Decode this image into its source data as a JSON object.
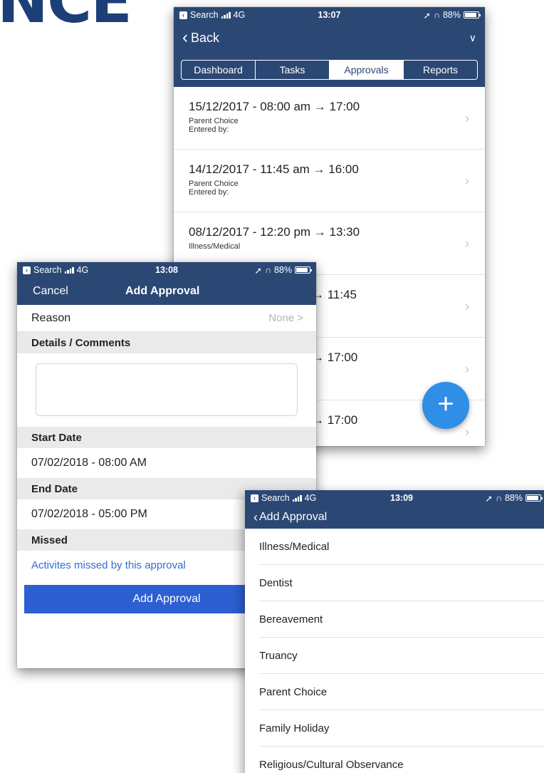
{
  "phone_list": {
    "status": {
      "back_app": "Search",
      "network": "4G",
      "time": "13:07",
      "battery": "88%"
    },
    "nav": {
      "back_label": "Back"
    },
    "tabs": [
      {
        "label": "Dashboard",
        "active": false
      },
      {
        "label": "Tasks",
        "active": false
      },
      {
        "label": "Approvals",
        "active": true
      },
      {
        "label": "Reports",
        "active": false
      }
    ],
    "entries": [
      {
        "title": "15/12/2017 - 08:00 am → 17:00",
        "reason": "Parent Choice",
        "entered_by": "Entered by:"
      },
      {
        "title": "14/12/2017 - 11:45 am → 16:00",
        "reason": "Parent Choice",
        "entered_by": "Entered by:"
      },
      {
        "title": "08/12/2017 - 12:20 pm → 13:30",
        "reason": "Illness/Medical",
        "entered_by": ""
      },
      {
        "title": "→ 11:45",
        "reason": "",
        "entered_by": ""
      },
      {
        "title": "→ 17:00",
        "reason": "",
        "entered_by": ""
      },
      {
        "title": "→ 17:00",
        "reason": "",
        "entered_by": ""
      }
    ],
    "fab_icon": "+"
  },
  "phone_form": {
    "status": {
      "back_app": "Search",
      "network": "4G",
      "time": "13:08",
      "battery": "88%"
    },
    "nav": {
      "cancel_label": "Cancel",
      "title": "Add Approval"
    },
    "reason_label": "Reason",
    "reason_value": "None >",
    "details_header": "Details / Comments",
    "start_header": "Start Date",
    "start_value": "07/02/2018 - 08:00 AM",
    "end_header": "End Date",
    "end_value": "07/02/2018 - 05:00 PM",
    "missed_header": "Missed",
    "missed_link": "Activites missed by this approval",
    "submit_label": "Add Approval"
  },
  "phone_reasons": {
    "status": {
      "back_app": "Search",
      "network": "4G",
      "time": "13:09",
      "battery": "88%"
    },
    "nav": {
      "back_label": "Add Approval"
    },
    "options": [
      "Illness/Medical",
      "Dentist",
      "Bereavement",
      "Truancy",
      "Parent Choice",
      "Family Holiday",
      "Religious/Cultural Observance"
    ]
  },
  "colors": {
    "nav": "#2b4874",
    "accent_button": "#2d5fd2",
    "fab": "#2f8ee5",
    "link": "#2f6fcf"
  }
}
